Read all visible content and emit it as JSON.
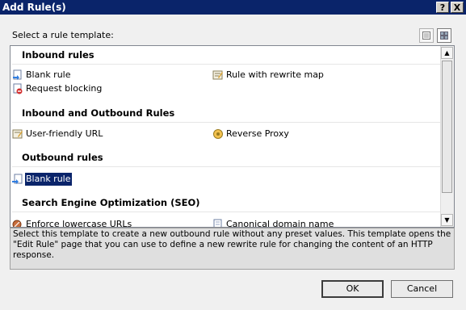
{
  "dialog": {
    "title": "Add Rule(s)",
    "help_label": "?",
    "close_label": "X",
    "prompt": "Select a rule template:"
  },
  "groups": [
    {
      "header": "Inbound rules"
    },
    {
      "header": "Inbound and Outbound Rules"
    },
    {
      "header": "Outbound rules"
    },
    {
      "header": "Search Engine Optimization (SEO)"
    }
  ],
  "items": [
    {
      "label": "Blank rule",
      "icon": "blank-rule-inbound-icon"
    },
    {
      "label": "Rule with rewrite map",
      "icon": "rewrite-map-icon"
    },
    {
      "label": "Request blocking",
      "icon": "request-blocking-icon"
    },
    {
      "label": "User-friendly URL",
      "icon": "user-friendly-url-icon"
    },
    {
      "label": "Reverse Proxy",
      "icon": "reverse-proxy-icon"
    },
    {
      "label": "Blank rule",
      "icon": "blank-rule-outbound-icon",
      "selected": true
    },
    {
      "label": "Enforce lowercase URLs",
      "icon": "enforce-lowercase-icon"
    },
    {
      "label": "Canonical domain name",
      "icon": "canonical-domain-icon"
    }
  ],
  "description": "Select this template to create a new outbound rule without any preset values. This template opens the \"Edit Rule\" page that you can use to define a new rewrite rule for changing the content of an HTTP response.",
  "buttons": {
    "ok": "OK",
    "cancel": "Cancel"
  },
  "scrollbar": {
    "up": "▲",
    "down": "▼"
  },
  "view_modes": [
    "details-view",
    "tiles-view"
  ]
}
